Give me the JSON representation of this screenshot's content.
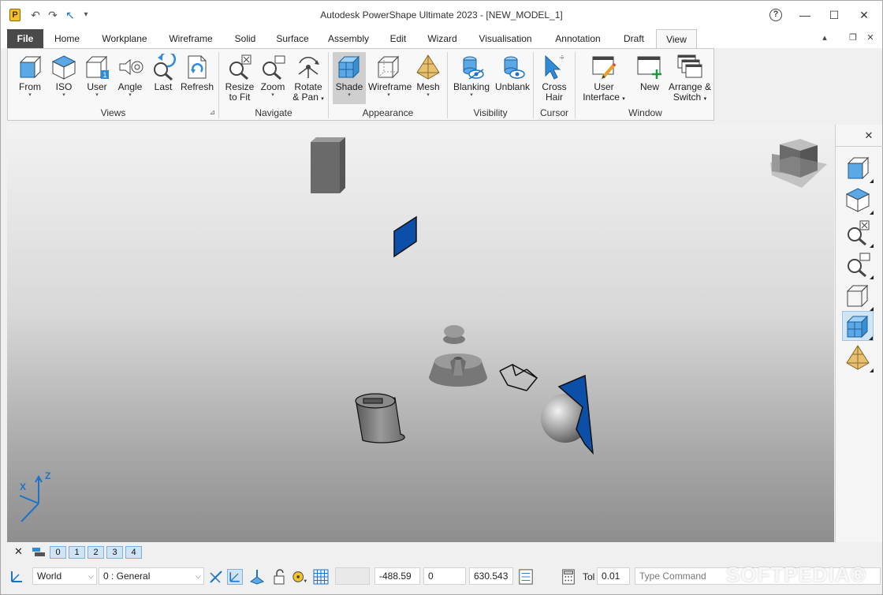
{
  "window": {
    "title": "Autodesk PowerShape Ultimate 2023 - [NEW_MODEL_1]",
    "logo_letter": "P",
    "help": "?",
    "minimize": "—",
    "maximize": "☐",
    "close": "✕"
  },
  "quick_access": {
    "undo": "↶",
    "redo": "↷",
    "select": "↖",
    "customize": "▾"
  },
  "tabs": [
    {
      "label": "File"
    },
    {
      "label": "Home"
    },
    {
      "label": "Workplane"
    },
    {
      "label": "Wireframe"
    },
    {
      "label": "Solid"
    },
    {
      "label": "Surface"
    },
    {
      "label": "Assembly"
    },
    {
      "label": "Edit"
    },
    {
      "label": "Wizard"
    },
    {
      "label": "Visualisation"
    },
    {
      "label": "Annotation"
    },
    {
      "label": "Draft"
    },
    {
      "label": "View"
    }
  ],
  "active_tab": "View",
  "tab_controls": {
    "pin": "▴",
    "restore": "❐",
    "close": "✕"
  },
  "ribbon": {
    "groups": {
      "views": "Views",
      "navigate": "Navigate",
      "appearance": "Appearance",
      "visibility": "Visibility",
      "cursor": "Cursor",
      "window": "Window"
    },
    "buttons": {
      "from": "From",
      "iso": "ISO",
      "user": "User",
      "angle": "Angle",
      "last": "Last",
      "refresh": "Refresh",
      "resize1": "Resize",
      "resize2": "to Fit",
      "zoom": "Zoom",
      "rotate1": "Rotate",
      "rotate2": "& Pan",
      "shade": "Shade",
      "wireframe": "Wireframe",
      "mesh": "Mesh",
      "blanking": "Blanking",
      "unblank": "Unblank",
      "cross1": "Cross",
      "cross2": "Hair",
      "ui1": "User",
      "ui2": "Interface",
      "new": "New",
      "arrange1": "Arrange &",
      "arrange2": "Switch"
    },
    "dropdown_arrow": "▾",
    "launcher": "⊿"
  },
  "sidebar": {
    "close": "✕"
  },
  "levels": {
    "close": "✕",
    "items": [
      "0",
      "1",
      "2",
      "3",
      "4"
    ]
  },
  "status": {
    "workplane": "World",
    "level": "0   : General",
    "x": "-488.59",
    "y": "0",
    "z": "630.543",
    "tol_label": "Tol",
    "tol": "0.01",
    "command_placeholder": "Type Command",
    "watermark": "SOFTPEDIA®"
  },
  "colors": {
    "accent_blue": "#2f8bd6",
    "file_tab": "#4a4a4a",
    "level_button": "#cfe4f5"
  }
}
